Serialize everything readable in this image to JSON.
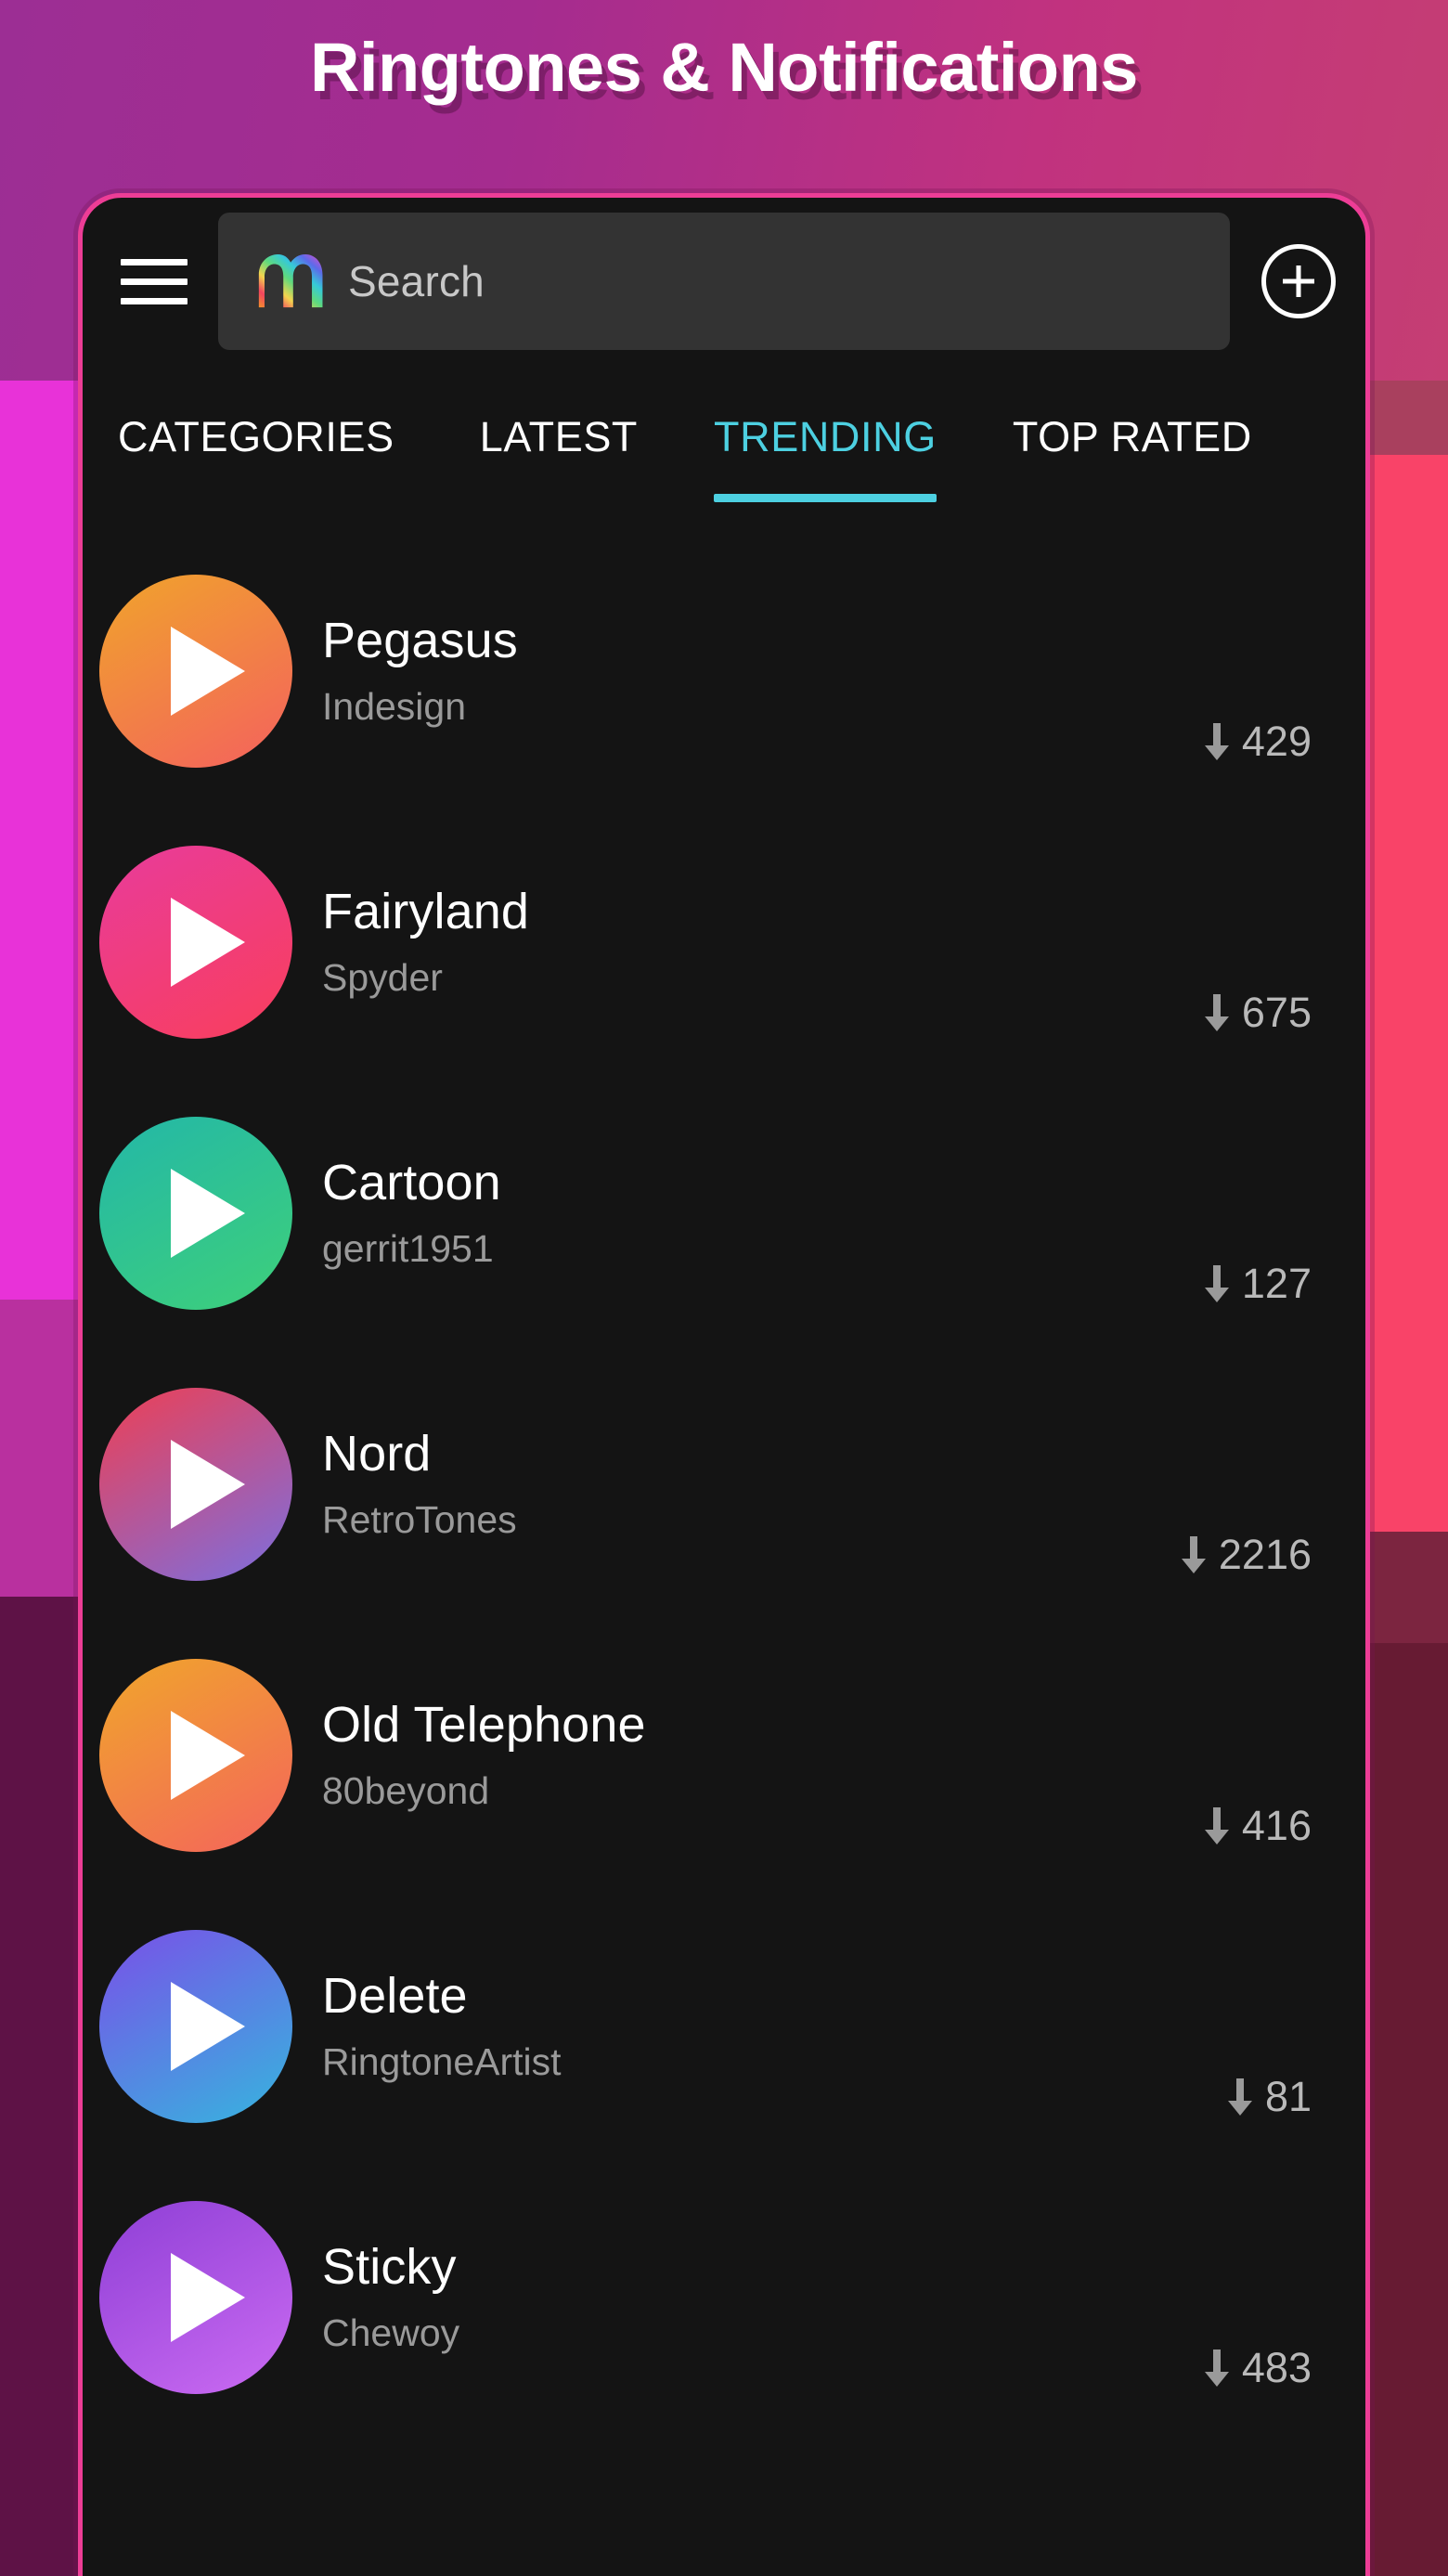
{
  "page": {
    "title": "Ringtones & Notifications"
  },
  "appbar": {
    "menu_icon": "hamburger-menu-icon",
    "brand_icon": "rainbow-m-logo-icon",
    "search_placeholder": "Search",
    "add_label": "add-icon"
  },
  "tabs": {
    "items": [
      {
        "label": "CATEGORIES",
        "active": false
      },
      {
        "label": "LATEST",
        "active": false
      },
      {
        "label": "TRENDING",
        "active": true
      },
      {
        "label": "TOP RATED",
        "active": false
      }
    ],
    "active_color": "#4DD0E1",
    "inactive_color": "#FFFFFF"
  },
  "list": {
    "items": [
      {
        "title": "Pegasus",
        "artist": "Indesign",
        "downloads": "429",
        "gradient_from": "#F0A42B",
        "gradient_to": "#F4615E"
      },
      {
        "title": "Fairyland",
        "artist": "Spyder",
        "downloads": "675",
        "gradient_from": "#E83C9B",
        "gradient_to": "#F93E5C"
      },
      {
        "title": "Cartoon",
        "artist": "gerrit1951",
        "downloads": "127",
        "gradient_from": "#23B7A8",
        "gradient_to": "#3ED07A"
      },
      {
        "title": "Nord",
        "artist": "RetroTones",
        "downloads": "2216",
        "gradient_from": "#EE3F53",
        "gradient_to": "#7B6FE0"
      },
      {
        "title": "Old Telephone",
        "artist": "80beyond",
        "downloads": "416",
        "gradient_from": "#F0A62B",
        "gradient_to": "#F4645C"
      },
      {
        "title": "Delete",
        "artist": "RingtoneArtist",
        "downloads": "81",
        "gradient_from": "#7A4FE8",
        "gradient_to": "#35B6DE"
      },
      {
        "title": "Sticky",
        "artist": "Chewoy",
        "downloads": "483",
        "gradient_from": "#8E3FD6",
        "gradient_to": "#CB6BF2"
      }
    ],
    "download_icon": "download-arrow-icon"
  },
  "theme": {
    "phone_border": "#ED3D96",
    "screen_bg": "#141414",
    "search_field_bg": "#333333",
    "title_color": "#FFFFFF"
  }
}
